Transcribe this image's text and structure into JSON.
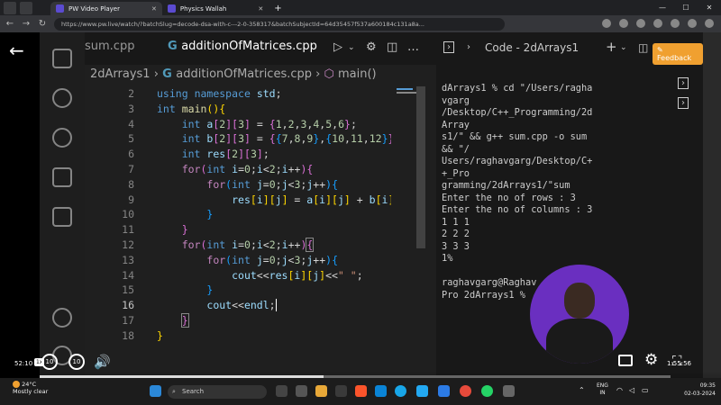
{
  "browser": {
    "tabs": [
      {
        "label": "PW Video Player",
        "active": true
      },
      {
        "label": "Physics Wallah",
        "active": false
      }
    ],
    "new_tab": "+",
    "url": "https://www.pw.live/watch/?batchSlug=decode-dsa-with-c---2-0-358317&batchSubjectId=64d35457f537a600184c131a8a..."
  },
  "vscode": {
    "tabs": [
      {
        "label": "sum.cpp",
        "active": false
      },
      {
        "label": "additionOfMatrices.cpp",
        "active": true
      }
    ],
    "breadcrumb": {
      "folder": "2dArrays1",
      "file": "additionOfMatrices.cpp",
      "symbol": "main()"
    },
    "lines": [
      {
        "n": "2",
        "html": "<span class='k'>using</span> <span class='k'>namespace</span> <span class='v'>std</span>;"
      },
      {
        "n": "3",
        "html": "<span class='k'>int</span> <span class='f'>main</span><span class='b1'>()</span><span class='b1'>{</span>"
      },
      {
        "n": "4",
        "html": "    <span class='k'>int</span> <span class='v'>a</span><span class='b2'>[</span><span class='n'>2</span><span class='b2'>]</span><span class='b2'>[</span><span class='n'>3</span><span class='b2'>]</span> = <span class='b2'>{</span><span class='n'>1</span>,<span class='n'>2</span>,<span class='n'>3</span>,<span class='n'>4</span>,<span class='n'>5</span>,<span class='n'>6</span><span class='b2'>}</span>;"
      },
      {
        "n": "5",
        "html": "    <span class='k'>int</span> <span class='v'>b</span><span class='b2'>[</span><span class='n'>2</span><span class='b2'>]</span><span class='b2'>[</span><span class='n'>3</span><span class='b2'>]</span> = <span class='b2'>{</span><span class='b3'>{</span><span class='n'>7</span>,<span class='n'>8</span>,<span class='n'>9</span><span class='b3'>}</span>,<span class='b3'>{</span><span class='n'>10</span>,<span class='n'>11</span>,<span class='n'>12</span><span class='b3'>}</span><span class='b2'>}</span>;"
      },
      {
        "n": "6",
        "html": "    <span class='k'>int</span> <span class='v'>res</span><span class='b2'>[</span><span class='n'>2</span><span class='b2'>]</span><span class='b2'>[</span><span class='n'>3</span><span class='b2'>]</span>;"
      },
      {
        "n": "7",
        "html": "    <span class='cf'>for</span><span class='b2'>(</span><span class='k'>int</span> <span class='v'>i</span>=<span class='n'>0</span>;<span class='v'>i</span>&lt;<span class='n'>2</span>;<span class='v'>i</span>++<span class='b2'>)</span><span class='b2'>{</span>"
      },
      {
        "n": "8",
        "html": "        <span class='cf'>for</span><span class='b3'>(</span><span class='k'>int</span> <span class='v'>j</span>=<span class='n'>0</span>;<span class='v'>j</span>&lt;<span class='n'>3</span>;<span class='v'>j</span>++<span class='b3'>)</span><span class='b3'>{</span>"
      },
      {
        "n": "9",
        "html": "            <span class='v'>res</span><span class='b1'>[</span><span class='v'>i</span><span class='b1'>]</span><span class='b1'>[</span><span class='v'>j</span><span class='b1'>]</span> = <span class='v'>a</span><span class='b1'>[</span><span class='v'>i</span><span class='b1'>]</span><span class='b1'>[</span><span class='v'>j</span><span class='b1'>]</span> + <span class='v'>b</span><span class='b1'>[</span><span class='v'>i</span><span class='b1'>]</span><span class='b1'>[</span><span class='v'>j</span><span class='b1'>]</span>;"
      },
      {
        "n": "10",
        "html": "        <span class='b3'>}</span>"
      },
      {
        "n": "11",
        "html": "    <span class='b2'>}</span>"
      },
      {
        "n": "12",
        "html": "    <span class='cf'>for</span><span class='b2'>(</span><span class='k'>int</span> <span class='v'>i</span>=<span class='n'>0</span>;<span class='v'>i</span>&lt;<span class='n'>2</span>;<span class='v'>i</span>++<span class='b2'>)</span><span class='b2' style='outline:1px solid #888'>{</span>"
      },
      {
        "n": "13",
        "html": "        <span class='cf'>for</span><span class='b3'>(</span><span class='k'>int</span> <span class='v'>j</span>=<span class='n'>0</span>;<span class='v'>j</span>&lt;<span class='n'>3</span>;<span class='v'>j</span>++<span class='b3'>)</span><span class='b3'>{</span>"
      },
      {
        "n": "14",
        "html": "            <span class='v'>cout</span>&lt;&lt;<span class='v'>res</span><span class='b1'>[</span><span class='v'>i</span><span class='b1'>]</span><span class='b1'>[</span><span class='v'>j</span><span class='b1'>]</span>&lt;&lt;<span class='s'>\" \"</span>;"
      },
      {
        "n": "15",
        "html": "        <span class='b3'>}</span>"
      },
      {
        "n": "16",
        "html": "        <span class='v'>cout</span>&lt;&lt;<span class='v'>endl</span>;<span style='border-left:1.5px solid #fff'></span>"
      },
      {
        "n": "17",
        "html": "    <span class='b2' style='outline:1px solid #888'>}</span>"
      },
      {
        "n": "18",
        "html": "<span class='b1'>}</span>"
      }
    ],
    "current_line": "16",
    "terminal": {
      "title": "Code - 2dArrays1",
      "text": "dArrays1 % cd \"/Users/ragha\nvgarg\n/Desktop/C++_Programming/2d\nArray\ns1/\" && g++ sum.cpp -o sum\n&& \"/\nUsers/raghavgarg/Desktop/C+\n+_Pro\ngramming/2dArrays1/\"sum\nEnter the no of rows : 3\nEnter the no of columns : 3\n1 1 1\n2 2 2\n3 3 3\n1%\n\nraghavgarg@Raghav\nPro 2dArrays1 %"
    }
  },
  "feedback_label": "Feedback",
  "player": {
    "current_time": "52:10",
    "duration": "1:55:56",
    "speed": "1x",
    "progress": 0.45,
    "skip_back": "10",
    "skip_forward": "10"
  },
  "taskbar": {
    "weather_temp": "24°C",
    "weather_desc": "Mostly clear",
    "search_placeholder": "Search",
    "lang_line1": "ENG",
    "lang_line2": "IN",
    "time": "09:35",
    "date": "02-03-2024"
  }
}
